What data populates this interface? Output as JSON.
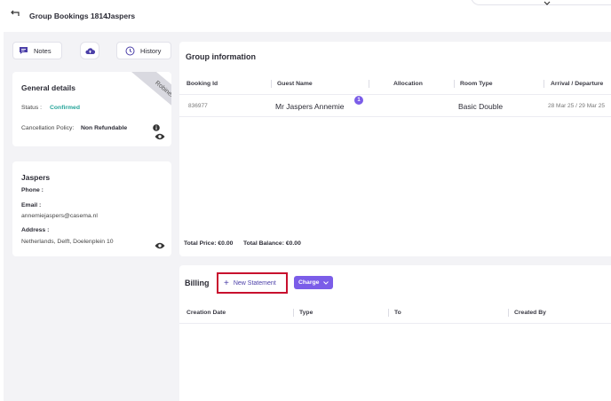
{
  "header": {
    "title": "Group Bookings 1814",
    "group_name": "Jaspers",
    "back_icon": "back-arrow-icon"
  },
  "toolbar": {
    "notes_label": "Notes",
    "history_label": "History"
  },
  "general": {
    "title": "General details",
    "ribbon": "Robinexp",
    "status_label": "Status :",
    "status_value": "Confirmed",
    "policy_label": "Cancellation Policy:",
    "policy_value": "Non Refundable"
  },
  "contact": {
    "name": "Jaspers",
    "phone_label": "Phone :",
    "email_label": "Email :",
    "email_value": "annemiejaspers@casema.nl",
    "address_label": "Address :",
    "address_value": "Netherlands, Delft, Doelenplein 10"
  },
  "group_info": {
    "title": "Group information",
    "columns": [
      "Booking Id",
      "Guest Name",
      "Allocation",
      "Room Type",
      "Arrival / Departure"
    ],
    "rows": [
      {
        "booking_id": "836977",
        "guest_name": "Mr Jaspers Annemie",
        "badge": "1",
        "allocation": "",
        "room_type": "Basic Double",
        "dates": "28 Mar 25 / 29 Mar 25"
      }
    ],
    "total_price": "Total Price: €0.00",
    "total_balance": "Total Balance: €0.00"
  },
  "billing": {
    "title": "Billing",
    "new_statement_label": "New Statement",
    "charge_label": "Charge",
    "columns": [
      "Creation Date",
      "Type",
      "To",
      "Created By"
    ]
  },
  "colors": {
    "accent": "#7b5de8",
    "status": "#27a59a",
    "highlight_border": "#c8102e"
  }
}
